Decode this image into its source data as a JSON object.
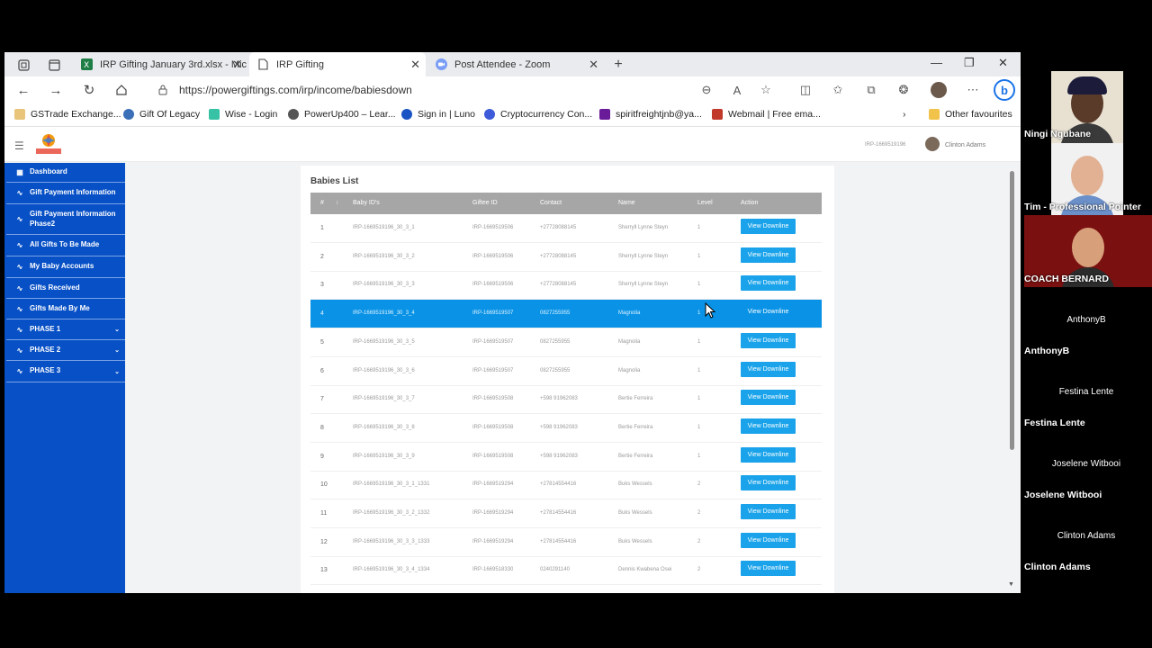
{
  "browser": {
    "tabs": [
      {
        "label": "IRP Gifting January 3rd.xlsx - Mic",
        "icon": "excel-icon",
        "active": false
      },
      {
        "label": "IRP Gifting",
        "icon": "page-icon",
        "active": true
      },
      {
        "label": "Post Attendee - Zoom",
        "icon": "zoom-icon",
        "active": false
      }
    ],
    "url": "https://powergiftings.com/irp/income/babiesdown",
    "favorites": [
      {
        "label": "GSTrade Exchange...",
        "color": "#e8c57a"
      },
      {
        "label": "Gift Of Legacy",
        "color": "#3b6fb8"
      },
      {
        "label": "Wise - Login",
        "color": "#37c2a5"
      },
      {
        "label": "PowerUp400 – Lear...",
        "color": "#555555"
      },
      {
        "label": "Sign in | Luno",
        "color": "#1a54c4"
      },
      {
        "label": "Cryptocurrency Con...",
        "color": "#3d5bd8"
      },
      {
        "label": "spiritfreightjnb@ya...",
        "color": "#6a1b9a"
      },
      {
        "label": "Webmail | Free ema...",
        "color": "#c0392b"
      }
    ],
    "other_favourites": "Other favourites"
  },
  "header": {
    "user_id": "IRP-1669519196",
    "user_name": "Clinton Adams"
  },
  "sidebar": {
    "items": [
      {
        "label": "Dashboard",
        "icon": "grid-icon",
        "chevron": false
      },
      {
        "label": "Gift Payment Information",
        "icon": "pulse-icon",
        "chevron": false
      },
      {
        "label": "Gift Payment Information Phase2",
        "icon": "pulse-icon",
        "chevron": false
      },
      {
        "label": "All Gifts To Be Made",
        "icon": "pulse-icon",
        "chevron": false
      },
      {
        "label": "My Baby Accounts",
        "icon": "pulse-icon",
        "chevron": false
      },
      {
        "label": "Gifts Received",
        "icon": "pulse-icon",
        "chevron": false
      },
      {
        "label": "Gifts Made By Me",
        "icon": "pulse-icon",
        "chevron": false
      },
      {
        "label": "PHASE 1",
        "icon": "pulse-icon",
        "chevron": true
      },
      {
        "label": "PHASE 2",
        "icon": "pulse-icon",
        "chevron": true
      },
      {
        "label": "PHASE 3",
        "icon": "pulse-icon",
        "chevron": true
      }
    ]
  },
  "main": {
    "title": "Babies List",
    "columns": [
      "#",
      "Baby ID's",
      "Giftee ID",
      "Contact",
      "Name",
      "Level",
      "Action"
    ],
    "button_label": "View Downline",
    "selected_row": 4,
    "rows": [
      {
        "n": "1",
        "baby": "IRP-1669519196_30_3_1",
        "giftee": "IRP-1669519506",
        "contact": "+27728088145",
        "name": "Sherryll Lynne Steyn",
        "level": "1"
      },
      {
        "n": "2",
        "baby": "IRP-1669519196_30_3_2",
        "giftee": "IRP-1669519506",
        "contact": "+27728088145",
        "name": "Sherryll Lynne Steyn",
        "level": "1"
      },
      {
        "n": "3",
        "baby": "IRP-1669519196_30_3_3",
        "giftee": "IRP-1669519506",
        "contact": "+27728088145",
        "name": "Sherryll Lynne Steyn",
        "level": "1"
      },
      {
        "n": "4",
        "baby": "IRP-1669519196_30_3_4",
        "giftee": "IRP-1669519507",
        "contact": "0827255955",
        "name": "Magnolia",
        "level": "1"
      },
      {
        "n": "5",
        "baby": "IRP-1669519196_30_3_5",
        "giftee": "IRP-1669519507",
        "contact": "0827255955",
        "name": "Magnolia",
        "level": "1"
      },
      {
        "n": "6",
        "baby": "IRP-1669519196_30_3_6",
        "giftee": "IRP-1669519507",
        "contact": "0827255955",
        "name": "Magnolia",
        "level": "1"
      },
      {
        "n": "7",
        "baby": "IRP-1669519196_30_3_7",
        "giftee": "IRP-1669519508",
        "contact": "+598 91962083",
        "name": "Bertie Ferreira",
        "level": "1"
      },
      {
        "n": "8",
        "baby": "IRP-1669519196_30_3_8",
        "giftee": "IRP-1669519508",
        "contact": "+598 91962083",
        "name": "Bertie Ferreira",
        "level": "1"
      },
      {
        "n": "9",
        "baby": "IRP-1669519196_30_3_9",
        "giftee": "IRP-1669519508",
        "contact": "+598 91962083",
        "name": "Bertie Ferreira",
        "level": "1"
      },
      {
        "n": "10",
        "baby": "IRP-1669519196_30_3_1_1331",
        "giftee": "IRP-1669519294",
        "contact": "+27814554416",
        "name": "Buks Wessels",
        "level": "2"
      },
      {
        "n": "11",
        "baby": "IRP-1669519196_30_3_2_1332",
        "giftee": "IRP-1669519294",
        "contact": "+27814554416",
        "name": "Buks Wessels",
        "level": "2"
      },
      {
        "n": "12",
        "baby": "IRP-1669519196_30_3_3_1333",
        "giftee": "IRP-1669519294",
        "contact": "+27814554416",
        "name": "Buks Wessels",
        "level": "2"
      },
      {
        "n": "13",
        "baby": "IRP-1669519196_30_3_4_1334",
        "giftee": "IRP-1669518330",
        "contact": "0240291140",
        "name": "Dennis Kwabena Osei",
        "level": "2"
      }
    ]
  },
  "zoom": {
    "participants": [
      {
        "name": "Ningi Ngubane",
        "video": true
      },
      {
        "name": "Tim - Professional Pointer",
        "video": true
      },
      {
        "name": "COACH BERNARD",
        "video": true
      },
      {
        "name": "AnthonyB",
        "video": false
      },
      {
        "name": "Festina Lente",
        "video": false
      },
      {
        "name": "Joselene Witbooi",
        "video": false
      },
      {
        "name": "Clinton Adams",
        "video": false
      }
    ]
  }
}
